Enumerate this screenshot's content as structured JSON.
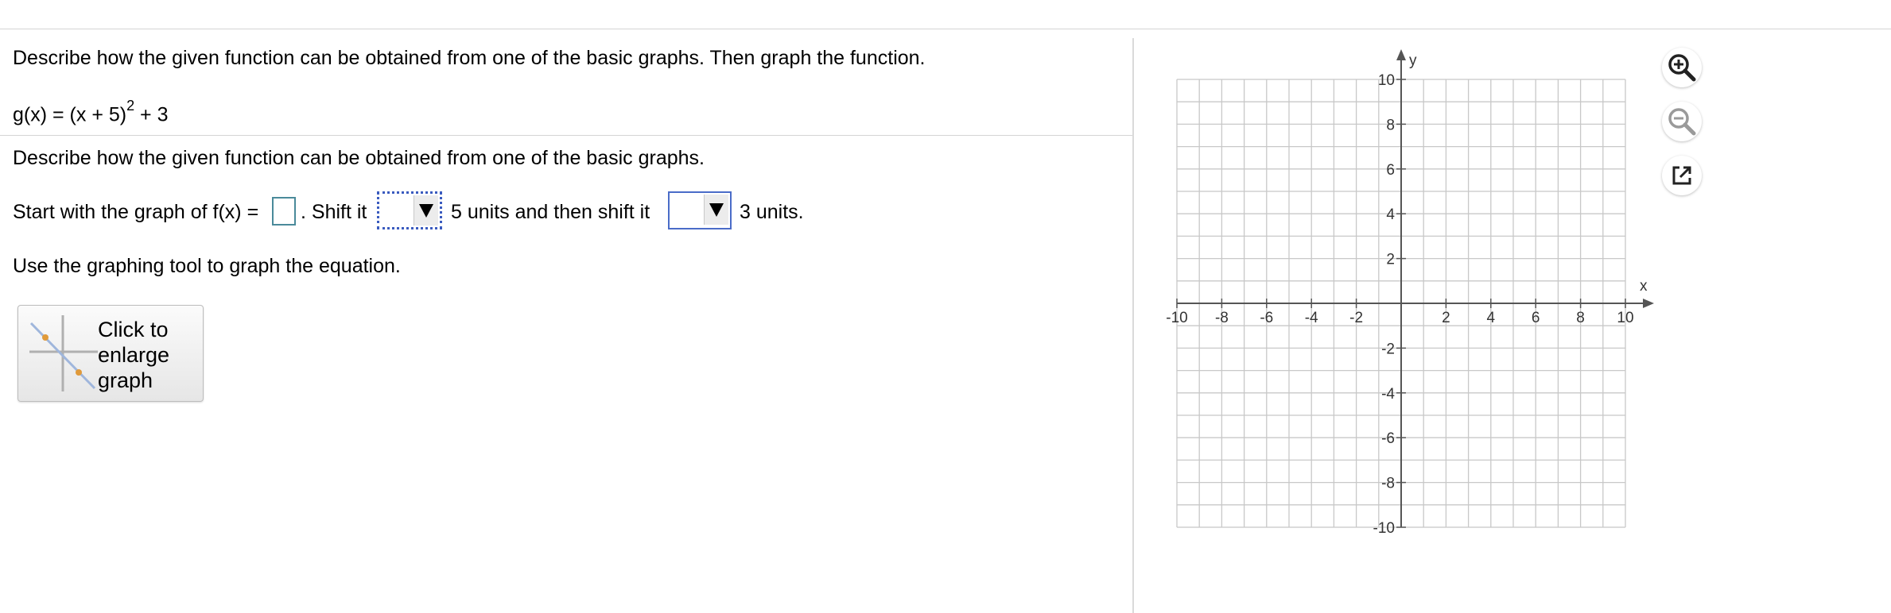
{
  "question": {
    "instruction": "Describe how the given function can be obtained from one of the basic graphs. Then graph the function.",
    "function_prefix": "g(x) = (x + 5)",
    "function_exponent": "2",
    "function_suffix": " + 3"
  },
  "part": {
    "instruction": "Describe how the given function can be obtained from one of the basic graphs.",
    "start_text": "Start with the graph of f(x) =",
    "answer_value": "",
    "after_box": ". Shift it",
    "dropdown1_value": "",
    "mid_text": "5 units and then shift it",
    "dropdown2_value": "",
    "end_text": "3 units."
  },
  "graphing": {
    "instruction": "Use the graphing tool to graph the equation.",
    "enlarge_button_label": "Click to\nenlarge\ngraph"
  },
  "graph": {
    "x_axis_label": "x",
    "y_axis_label": "y",
    "xlim": [
      -10,
      10
    ],
    "ylim": [
      -10,
      10
    ],
    "grid_step": 1,
    "x_tick_labels": [
      "-10",
      "-8",
      "-6",
      "-4",
      "-2",
      "2",
      "4",
      "6",
      "8",
      "10"
    ],
    "y_tick_labels": [
      "10",
      "8",
      "6",
      "4",
      "2",
      "-2",
      "-4",
      "-6",
      "-8",
      "-10"
    ],
    "grid_color": "#c8c8c8",
    "axis_color": "#555555"
  },
  "tools": {
    "zoom_in_icon": "zoom-in-icon",
    "zoom_out_icon": "zoom-out-icon",
    "popout_icon": "external-link-icon"
  }
}
